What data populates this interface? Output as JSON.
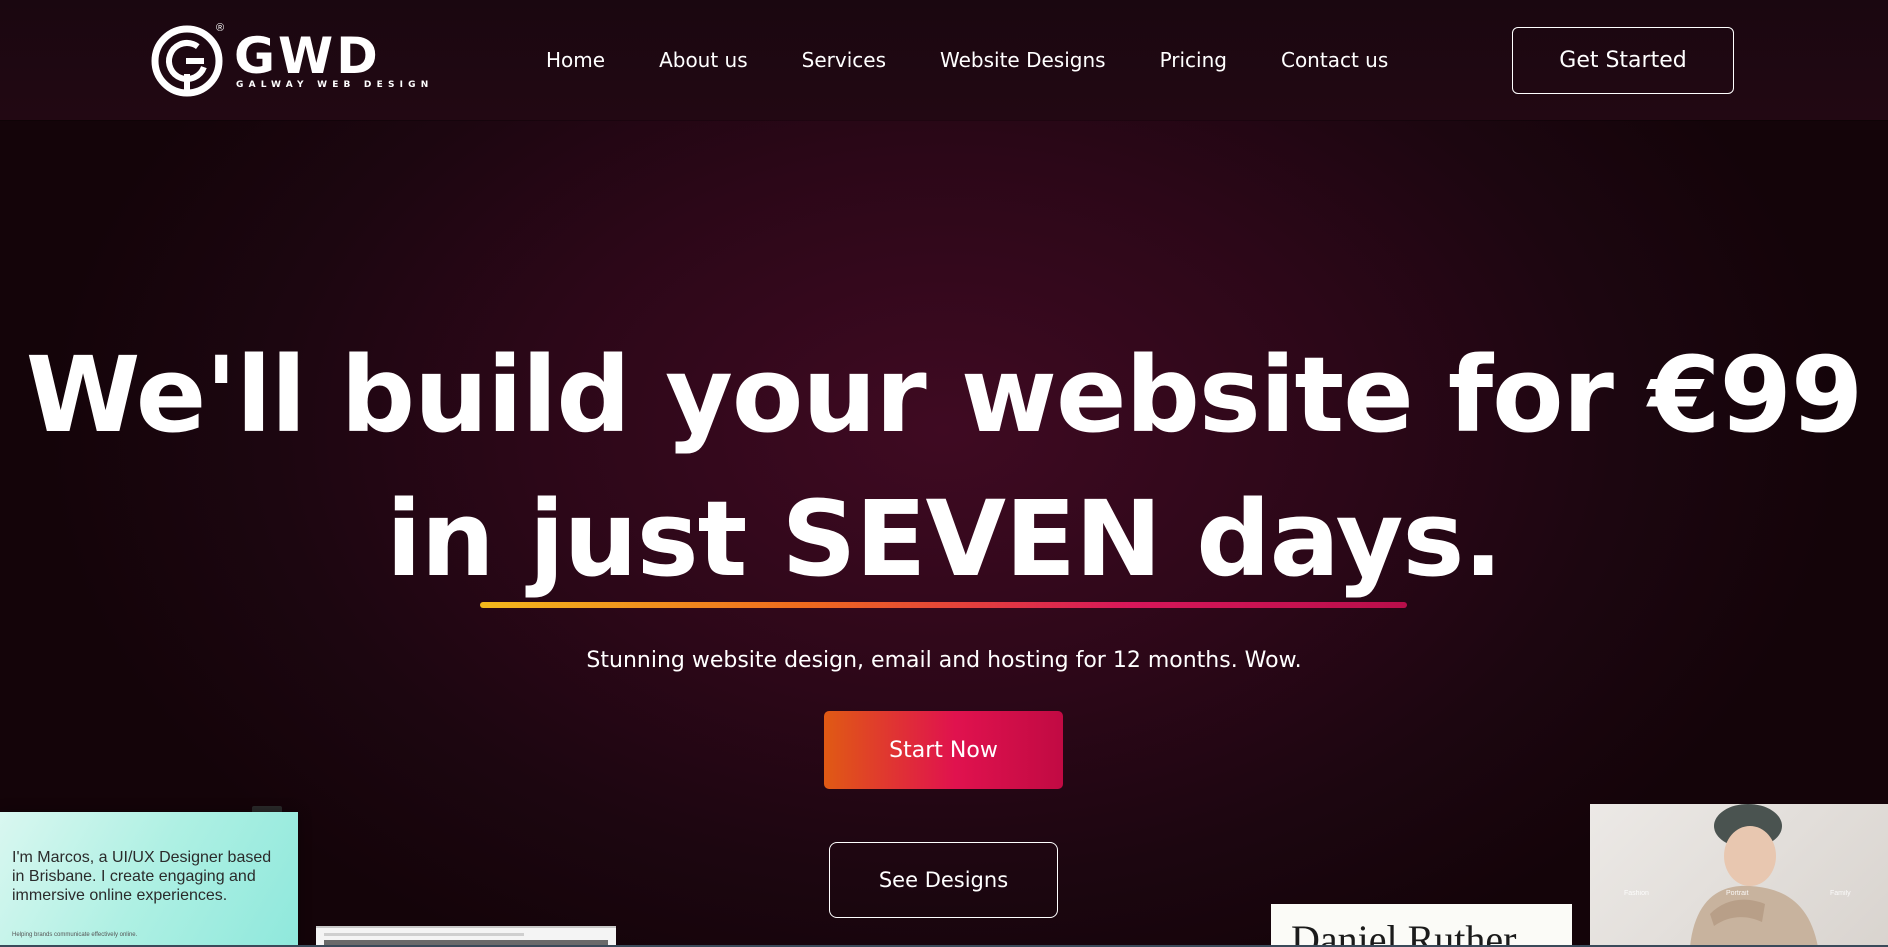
{
  "brand": {
    "name": "GWD",
    "tagline": "GALWAY WEB DESIGN",
    "registered_mark": "®"
  },
  "nav": {
    "items": [
      {
        "label": "Home"
      },
      {
        "label": "About us"
      },
      {
        "label": "Services"
      },
      {
        "label": "Website Designs"
      },
      {
        "label": "Pricing"
      },
      {
        "label": "Contact us"
      }
    ],
    "cta_label": "Get Started"
  },
  "hero": {
    "headline_line1": "We'll build your website for €99",
    "headline_line2": "in just SEVEN days.",
    "subtitle": "Stunning website design, email and hosting for 12 months. Wow.",
    "primary_button": "Start Now",
    "secondary_button": "See Designs"
  },
  "previews": {
    "marcos_text": "I'm Marcos, a UI/UX Designer based in Brisbane. I create engaging and immersive online experiences.",
    "marcos_small": "Helping brands communicate effectively online.",
    "daniel_text": "Daniel Ruther",
    "fashion_labels": [
      "Fashion",
      "Portrait",
      "Family"
    ]
  },
  "colors": {
    "background": "#2c0718",
    "accent_gradient_start": "#f2b81c",
    "accent_gradient_end": "#b80e4a",
    "button_gradient_start": "#e05a14",
    "button_gradient_end": "#c10a43",
    "text": "#ffffff"
  }
}
